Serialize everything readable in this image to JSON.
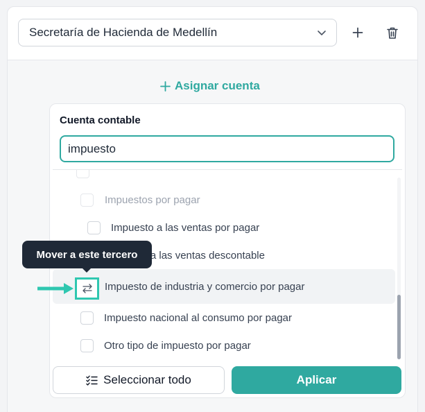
{
  "third_party": {
    "selected": "Secretaría de Hacienda de Medellín",
    "icons": {
      "dropdown": "chevron-down-icon",
      "add": "plus-icon",
      "delete": "trash-icon"
    }
  },
  "assign_account": {
    "label": "Asignar cuenta",
    "icon": "plus-icon"
  },
  "account_panel": {
    "label": "Cuenta contable",
    "search_value": "impuesto",
    "items": [
      {
        "label": "Impuestos por pagar",
        "state": "disabled"
      },
      {
        "label": "Impuesto a las ventas por pagar",
        "state": "default"
      },
      {
        "label": "Impuesto a las ventas descontable",
        "state": "default"
      },
      {
        "label": "Impuesto de industria y comercio por pagar",
        "state": "hovered",
        "icon": "swap-arrows-icon"
      },
      {
        "label": "Impuesto nacional al consumo por pagar",
        "state": "default"
      },
      {
        "label": "Otro tipo de impuesto por pagar",
        "state": "default"
      }
    ],
    "tooltip": "Mover a este tercero",
    "select_all_label": "Seleccionar todo",
    "select_all_icon": "checklist-icon",
    "apply_label": "Aplicar"
  },
  "colors": {
    "accent": "#2fa9a0",
    "annotation": "#2fc7b0",
    "tooltip_bg": "#1f2937",
    "page_bg": "#f3f4f6"
  }
}
